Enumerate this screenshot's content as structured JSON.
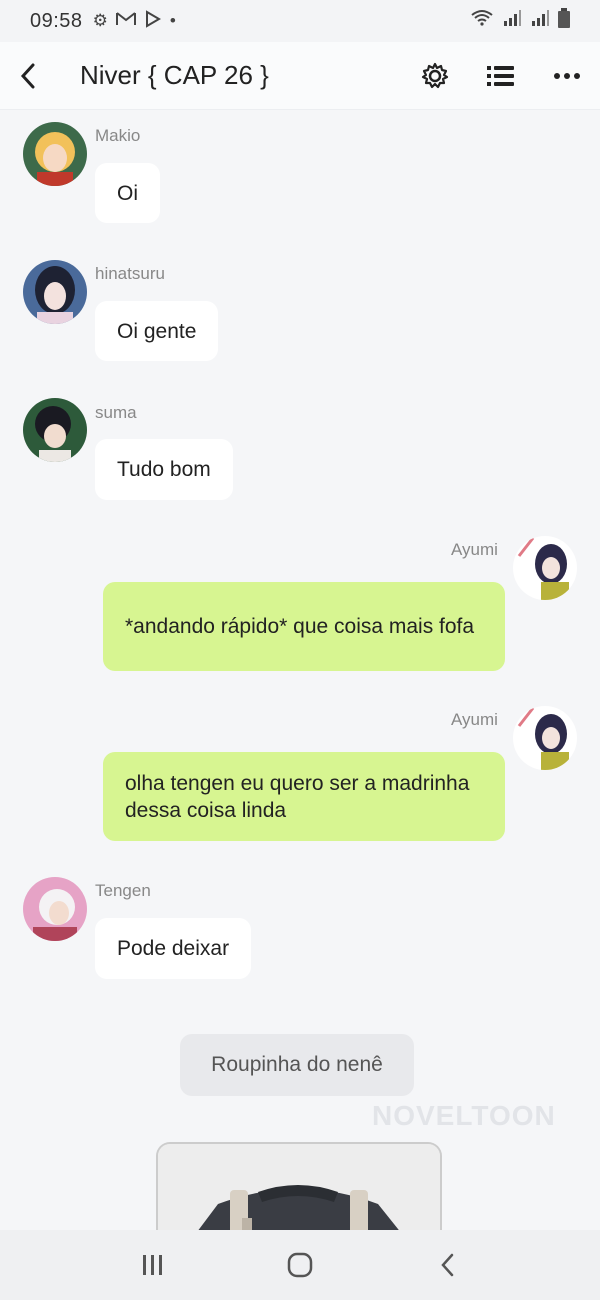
{
  "status": {
    "time": "09:58"
  },
  "header": {
    "title": "Niver { CAP 26 }"
  },
  "messages": [
    {
      "sender": "Makio",
      "text": "Oi"
    },
    {
      "sender": "hinatsuru",
      "text": "Oi gente"
    },
    {
      "sender": "suma",
      "text": "Tudo bom"
    },
    {
      "sender": "Ayumi",
      "text": "*andando rápido* que coisa mais fofa"
    },
    {
      "sender": "Ayumi",
      "text": "olha tengen eu quero ser a madrinha dessa coisa linda"
    },
    {
      "sender": "Tengen",
      "text": "Pode deixar"
    }
  ],
  "narration": {
    "text": "Roupinha do nenê"
  },
  "watermark": {
    "text": "NOVELTOON"
  },
  "colors": {
    "mine_bubble": "#d7f591",
    "other_bubble": "#ffffff",
    "background": "#f5f6f8"
  }
}
